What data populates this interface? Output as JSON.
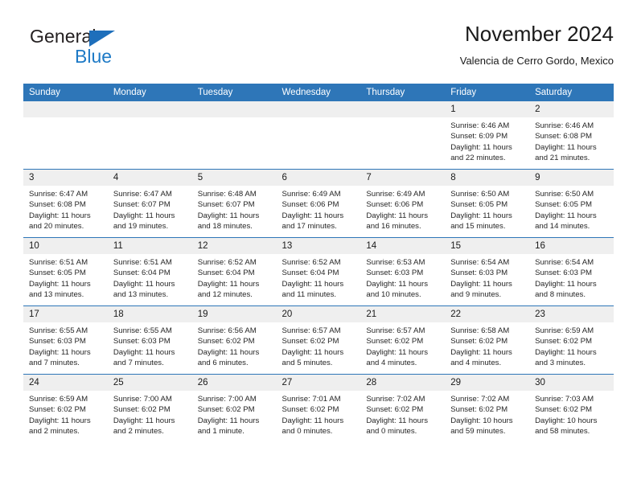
{
  "brand": {
    "name_top": "General",
    "name_bottom": "Blue",
    "triangle_icon": "brand-triangle-icon",
    "color_dark": "#231f20",
    "color_blue": "#1e7ac6"
  },
  "header": {
    "title": "November 2024",
    "subtitle": "Valencia de Cerro Gordo, Mexico"
  },
  "theme": {
    "header_blue": "#2e76b8",
    "day_strip_gray": "#efefef",
    "text": "#262626"
  },
  "weekday_headers": [
    "Sunday",
    "Monday",
    "Tuesday",
    "Wednesday",
    "Thursday",
    "Friday",
    "Saturday"
  ],
  "labels": {
    "sunrise_prefix": "Sunrise:",
    "sunset_prefix": "Sunset:",
    "daylight_prefix": "Daylight:"
  },
  "weeks": [
    [
      {
        "day": "",
        "empty": true
      },
      {
        "day": "",
        "empty": true
      },
      {
        "day": "",
        "empty": true
      },
      {
        "day": "",
        "empty": true
      },
      {
        "day": "",
        "empty": true
      },
      {
        "day": "1",
        "sunrise": "Sunrise: 6:46 AM",
        "sunset": "Sunset: 6:09 PM",
        "daylight_line1": "Daylight: 11 hours",
        "daylight_line2": "and 22 minutes."
      },
      {
        "day": "2",
        "sunrise": "Sunrise: 6:46 AM",
        "sunset": "Sunset: 6:08 PM",
        "daylight_line1": "Daylight: 11 hours",
        "daylight_line2": "and 21 minutes."
      }
    ],
    [
      {
        "day": "3",
        "sunrise": "Sunrise: 6:47 AM",
        "sunset": "Sunset: 6:08 PM",
        "daylight_line1": "Daylight: 11 hours",
        "daylight_line2": "and 20 minutes."
      },
      {
        "day": "4",
        "sunrise": "Sunrise: 6:47 AM",
        "sunset": "Sunset: 6:07 PM",
        "daylight_line1": "Daylight: 11 hours",
        "daylight_line2": "and 19 minutes."
      },
      {
        "day": "5",
        "sunrise": "Sunrise: 6:48 AM",
        "sunset": "Sunset: 6:07 PM",
        "daylight_line1": "Daylight: 11 hours",
        "daylight_line2": "and 18 minutes."
      },
      {
        "day": "6",
        "sunrise": "Sunrise: 6:49 AM",
        "sunset": "Sunset: 6:06 PM",
        "daylight_line1": "Daylight: 11 hours",
        "daylight_line2": "and 17 minutes."
      },
      {
        "day": "7",
        "sunrise": "Sunrise: 6:49 AM",
        "sunset": "Sunset: 6:06 PM",
        "daylight_line1": "Daylight: 11 hours",
        "daylight_line2": "and 16 minutes."
      },
      {
        "day": "8",
        "sunrise": "Sunrise: 6:50 AM",
        "sunset": "Sunset: 6:05 PM",
        "daylight_line1": "Daylight: 11 hours",
        "daylight_line2": "and 15 minutes."
      },
      {
        "day": "9",
        "sunrise": "Sunrise: 6:50 AM",
        "sunset": "Sunset: 6:05 PM",
        "daylight_line1": "Daylight: 11 hours",
        "daylight_line2": "and 14 minutes."
      }
    ],
    [
      {
        "day": "10",
        "sunrise": "Sunrise: 6:51 AM",
        "sunset": "Sunset: 6:05 PM",
        "daylight_line1": "Daylight: 11 hours",
        "daylight_line2": "and 13 minutes."
      },
      {
        "day": "11",
        "sunrise": "Sunrise: 6:51 AM",
        "sunset": "Sunset: 6:04 PM",
        "daylight_line1": "Daylight: 11 hours",
        "daylight_line2": "and 13 minutes."
      },
      {
        "day": "12",
        "sunrise": "Sunrise: 6:52 AM",
        "sunset": "Sunset: 6:04 PM",
        "daylight_line1": "Daylight: 11 hours",
        "daylight_line2": "and 12 minutes."
      },
      {
        "day": "13",
        "sunrise": "Sunrise: 6:52 AM",
        "sunset": "Sunset: 6:04 PM",
        "daylight_line1": "Daylight: 11 hours",
        "daylight_line2": "and 11 minutes."
      },
      {
        "day": "14",
        "sunrise": "Sunrise: 6:53 AM",
        "sunset": "Sunset: 6:03 PM",
        "daylight_line1": "Daylight: 11 hours",
        "daylight_line2": "and 10 minutes."
      },
      {
        "day": "15",
        "sunrise": "Sunrise: 6:54 AM",
        "sunset": "Sunset: 6:03 PM",
        "daylight_line1": "Daylight: 11 hours",
        "daylight_line2": "and 9 minutes."
      },
      {
        "day": "16",
        "sunrise": "Sunrise: 6:54 AM",
        "sunset": "Sunset: 6:03 PM",
        "daylight_line1": "Daylight: 11 hours",
        "daylight_line2": "and 8 minutes."
      }
    ],
    [
      {
        "day": "17",
        "sunrise": "Sunrise: 6:55 AM",
        "sunset": "Sunset: 6:03 PM",
        "daylight_line1": "Daylight: 11 hours",
        "daylight_line2": "and 7 minutes."
      },
      {
        "day": "18",
        "sunrise": "Sunrise: 6:55 AM",
        "sunset": "Sunset: 6:03 PM",
        "daylight_line1": "Daylight: 11 hours",
        "daylight_line2": "and 7 minutes."
      },
      {
        "day": "19",
        "sunrise": "Sunrise: 6:56 AM",
        "sunset": "Sunset: 6:02 PM",
        "daylight_line1": "Daylight: 11 hours",
        "daylight_line2": "and 6 minutes."
      },
      {
        "day": "20",
        "sunrise": "Sunrise: 6:57 AM",
        "sunset": "Sunset: 6:02 PM",
        "daylight_line1": "Daylight: 11 hours",
        "daylight_line2": "and 5 minutes."
      },
      {
        "day": "21",
        "sunrise": "Sunrise: 6:57 AM",
        "sunset": "Sunset: 6:02 PM",
        "daylight_line1": "Daylight: 11 hours",
        "daylight_line2": "and 4 minutes."
      },
      {
        "day": "22",
        "sunrise": "Sunrise: 6:58 AM",
        "sunset": "Sunset: 6:02 PM",
        "daylight_line1": "Daylight: 11 hours",
        "daylight_line2": "and 4 minutes."
      },
      {
        "day": "23",
        "sunrise": "Sunrise: 6:59 AM",
        "sunset": "Sunset: 6:02 PM",
        "daylight_line1": "Daylight: 11 hours",
        "daylight_line2": "and 3 minutes."
      }
    ],
    [
      {
        "day": "24",
        "sunrise": "Sunrise: 6:59 AM",
        "sunset": "Sunset: 6:02 PM",
        "daylight_line1": "Daylight: 11 hours",
        "daylight_line2": "and 2 minutes."
      },
      {
        "day": "25",
        "sunrise": "Sunrise: 7:00 AM",
        "sunset": "Sunset: 6:02 PM",
        "daylight_line1": "Daylight: 11 hours",
        "daylight_line2": "and 2 minutes."
      },
      {
        "day": "26",
        "sunrise": "Sunrise: 7:00 AM",
        "sunset": "Sunset: 6:02 PM",
        "daylight_line1": "Daylight: 11 hours",
        "daylight_line2": "and 1 minute."
      },
      {
        "day": "27",
        "sunrise": "Sunrise: 7:01 AM",
        "sunset": "Sunset: 6:02 PM",
        "daylight_line1": "Daylight: 11 hours",
        "daylight_line2": "and 0 minutes."
      },
      {
        "day": "28",
        "sunrise": "Sunrise: 7:02 AM",
        "sunset": "Sunset: 6:02 PM",
        "daylight_line1": "Daylight: 11 hours",
        "daylight_line2": "and 0 minutes."
      },
      {
        "day": "29",
        "sunrise": "Sunrise: 7:02 AM",
        "sunset": "Sunset: 6:02 PM",
        "daylight_line1": "Daylight: 10 hours",
        "daylight_line2": "and 59 minutes."
      },
      {
        "day": "30",
        "sunrise": "Sunrise: 7:03 AM",
        "sunset": "Sunset: 6:02 PM",
        "daylight_line1": "Daylight: 10 hours",
        "daylight_line2": "and 58 minutes."
      }
    ]
  ]
}
